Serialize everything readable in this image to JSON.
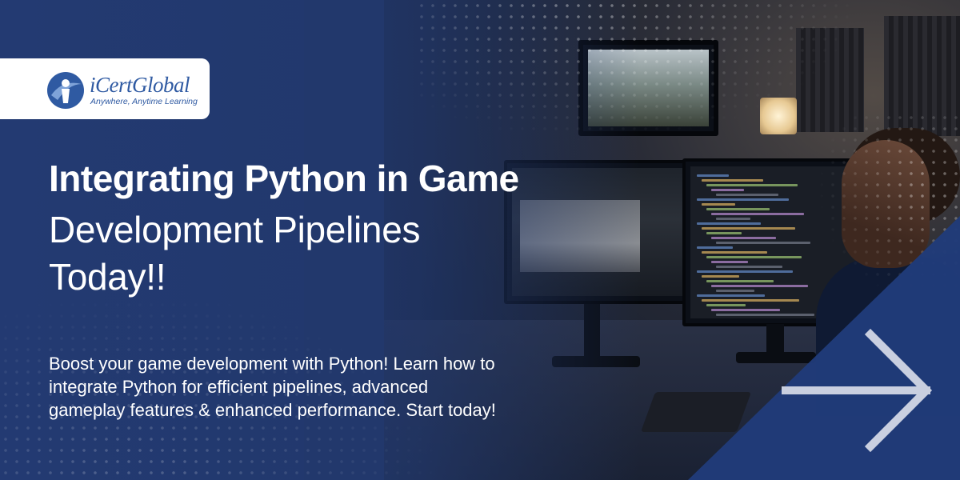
{
  "logo": {
    "name": "iCertGlobal",
    "tagline": "Anywhere, Anytime Learning",
    "icon": "icertglobal-logo-icon"
  },
  "headline": {
    "line1": "Integrating Python in Game",
    "line2": "Development Pipelines",
    "line3": "Today!!"
  },
  "description": "Boost your game development with Python! Learn how to integrate Python for efficient pipelines, advanced gameplay features & enhanced performance. Start today!",
  "cta": {
    "icon": "arrow-right-icon"
  },
  "colors": {
    "background": "#22386c",
    "accent_triangle": "#203b7a",
    "logo_blue": "#2f5aa2",
    "text": "#ffffff"
  }
}
